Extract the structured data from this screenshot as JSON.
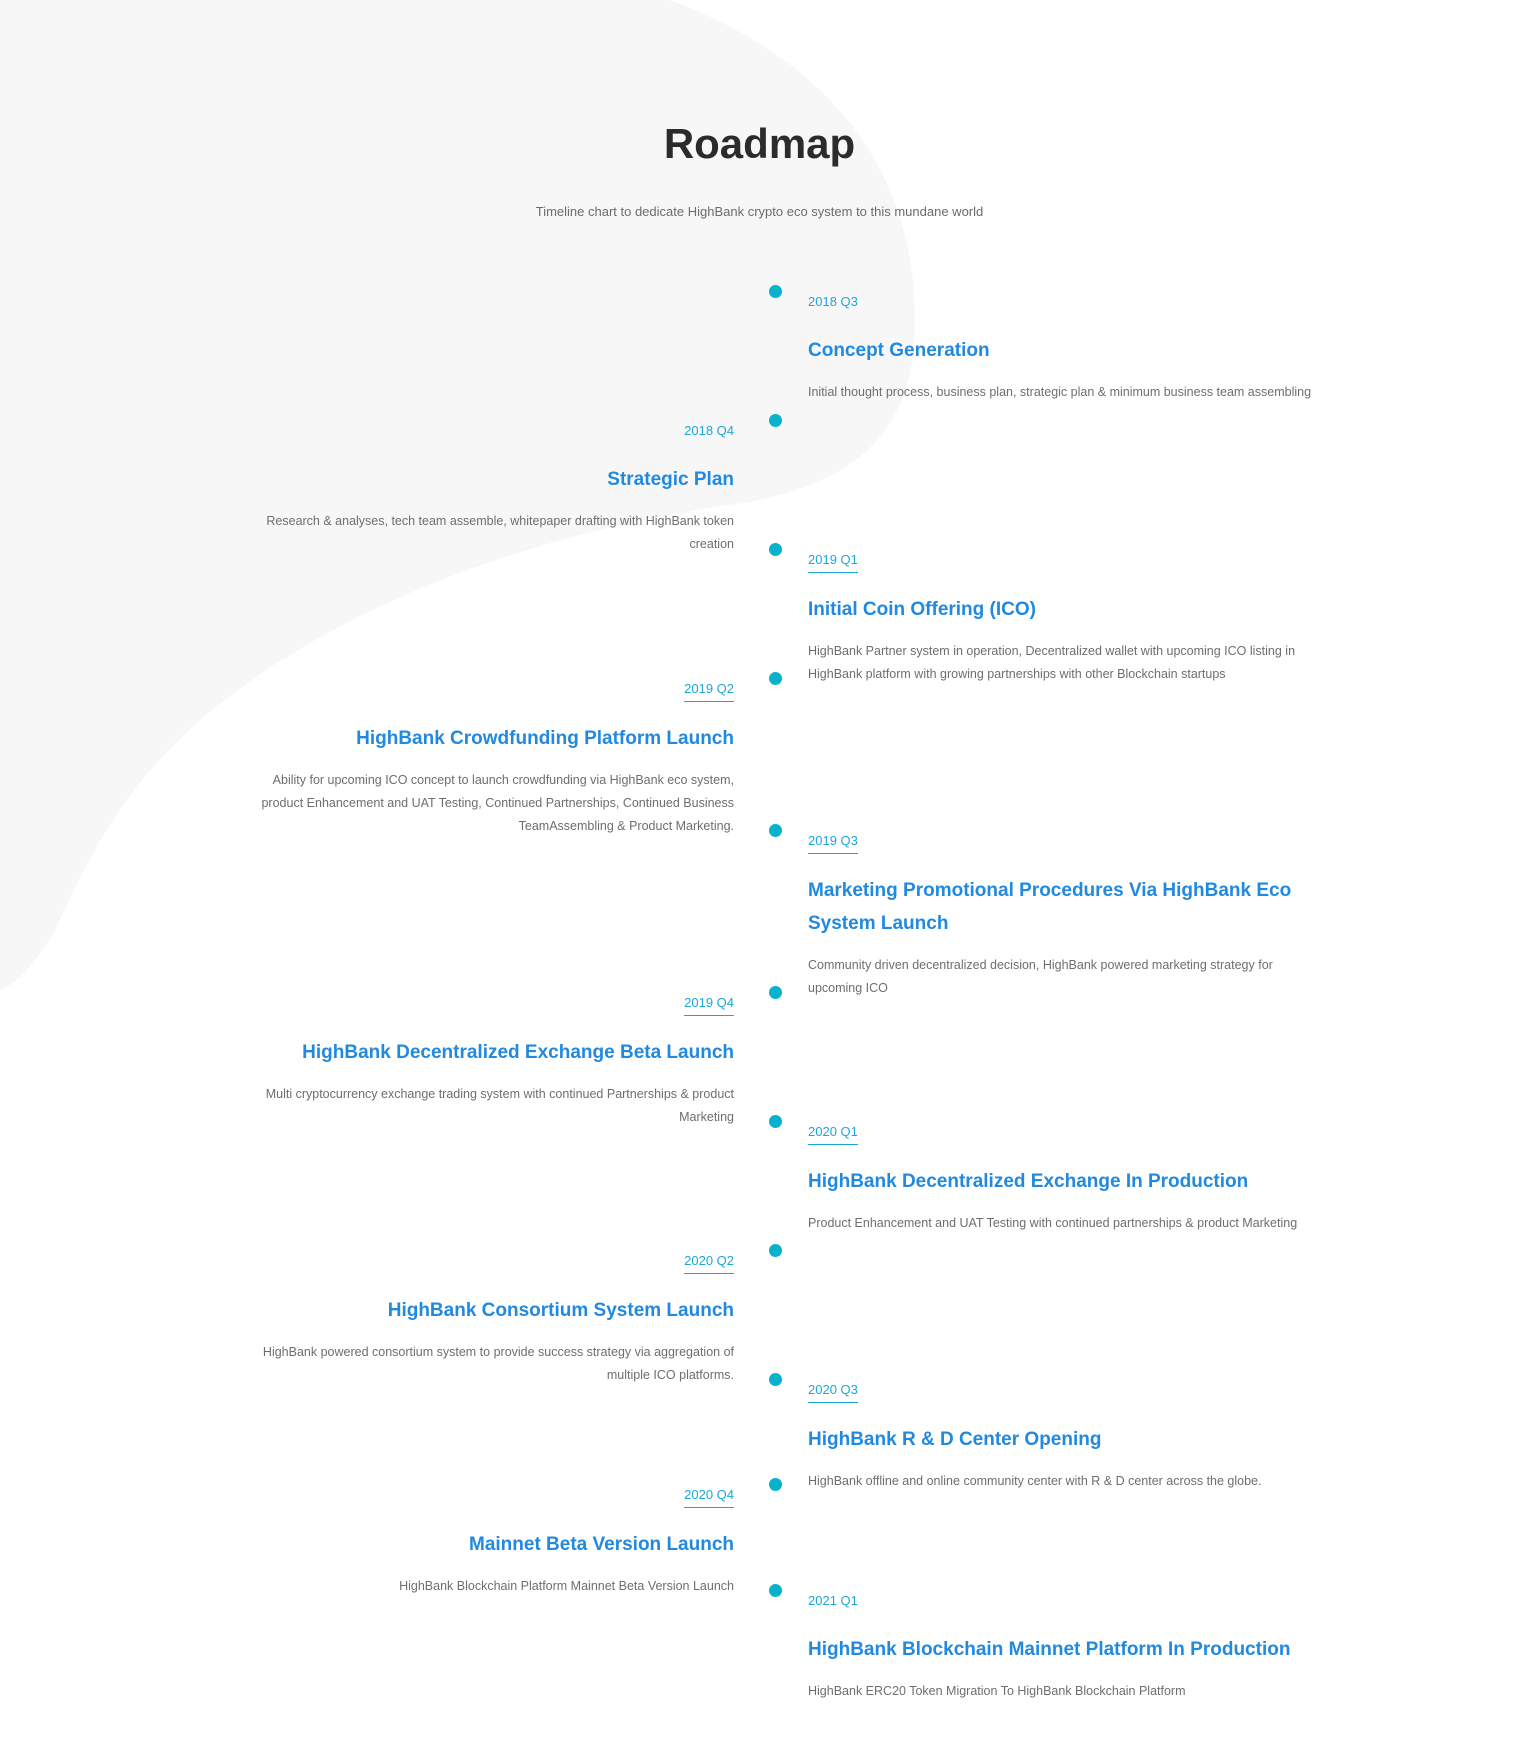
{
  "page": {
    "title": "Roadmap",
    "subtitle": "Timeline chart to dedicate HighBank crypto eco system to this mundane world"
  },
  "colors": {
    "accent": "#06b2cc",
    "heading": "#2189e0",
    "date": "#1da7d9",
    "text": "#6e6e6e",
    "background_shape": "#f7f7f7"
  },
  "milestones": [
    {
      "date": "2018 Q3",
      "title": "Concept Generation",
      "description": "Initial thought process, business plan, strategic plan & minimum business team assembling"
    },
    {
      "date": "2018 Q4",
      "title": "Strategic Plan",
      "description": "Research & analyses, tech team assemble, whitepaper drafting with HighBank token creation"
    },
    {
      "date": "2019 Q1",
      "title": "Initial Coin Offering (ICO)",
      "description": "HighBank Partner system in operation, Decentralized wallet with upcoming ICO listing in HighBank platform with growing partnerships with other Blockchain startups"
    },
    {
      "date": "2019 Q2",
      "title": "HighBank Crowdfunding Platform Launch",
      "description": "Ability for upcoming ICO concept to launch crowdfunding via HighBank eco system, product Enhancement and UAT Testing, Continued Partnerships, Continued Business TeamAssembling & Product Marketing."
    },
    {
      "date": "2019 Q3",
      "title": "Marketing Promotional Procedures Via HighBank Eco System Launch",
      "description": "Community driven decentralized decision, HighBank powered marketing strategy for upcoming ICO"
    },
    {
      "date": "2019 Q4",
      "title": "HighBank Decentralized Exchange Beta Launch",
      "description": "Multi cryptocurrency exchange trading system with continued Partnerships & product Marketing"
    },
    {
      "date": "2020 Q1",
      "title": "HighBank Decentralized Exchange In Production",
      "description": "Product Enhancement and UAT Testing with continued partnerships & product Marketing"
    },
    {
      "date": "2020 Q2",
      "title": "HighBank Consortium System Launch",
      "description": "HighBank powered consortium system to provide success strategy via aggregation of multiple ICO platforms."
    },
    {
      "date": "2020 Q3",
      "title": "HighBank R & D Center Opening",
      "description": "HighBank offline and online community center with R & D center across the globe."
    },
    {
      "date": "2020 Q4",
      "title": "Mainnet Beta Version Launch",
      "description": "HighBank Blockchain Platform Mainnet Beta Version Launch"
    },
    {
      "date": "2021 Q1",
      "title": "HighBank Blockchain Mainnet Platform In Production",
      "description": "HighBank ERC20 Token Migration To HighBank Blockchain Platform"
    }
  ]
}
